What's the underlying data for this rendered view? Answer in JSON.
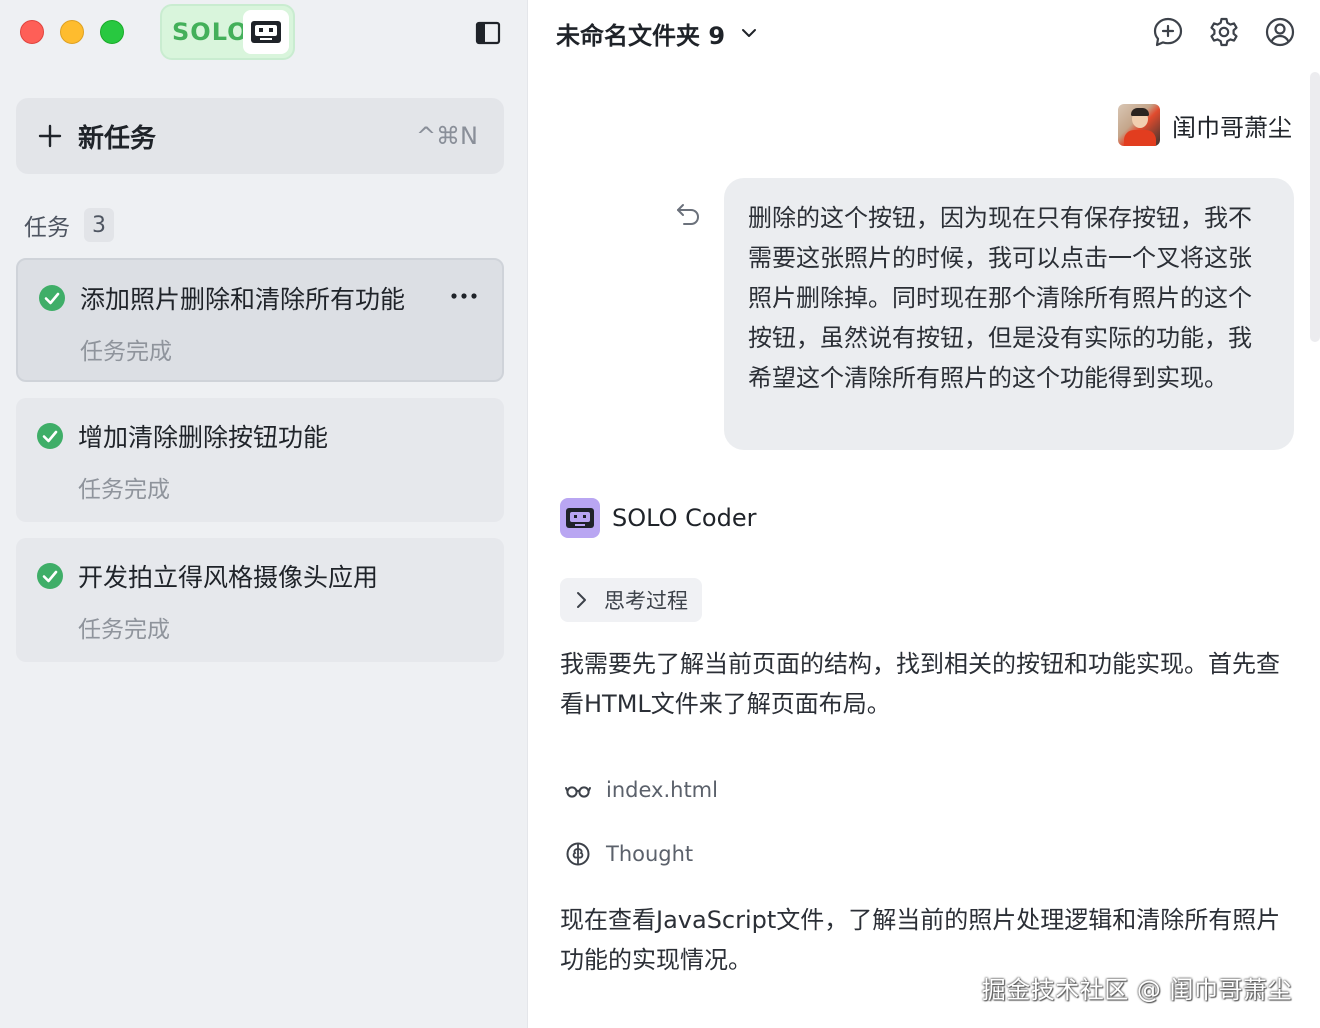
{
  "app": {
    "brand_label": "SOLO"
  },
  "sidebar": {
    "new_task": {
      "label": "新任务",
      "shortcut": "^⌘N"
    },
    "tasks_label": "任务",
    "tasks_count": "3",
    "tasks": [
      {
        "title": "添加照片删除和清除所有功能",
        "status": "任务完成",
        "active": true
      },
      {
        "title": "增加清除删除按钮功能",
        "status": "任务完成",
        "active": false
      },
      {
        "title": "开发拍立得风格摄像头应用",
        "status": "任务完成",
        "active": false
      }
    ]
  },
  "main": {
    "folder_title": "未命名文件夹 9",
    "user": {
      "name": "闺巾哥萧尘"
    },
    "user_message": "删除的这个按钮，因为现在只有保存按钮，我不需要这张照片的时候，我可以点击一个叉将这张照片删除掉。同时现在那个清除所有照片的这个按钮，虽然说有按钮，但是没有实际的功能，我希望这个清除所有照片的这个功能得到实现。",
    "agent": {
      "name": "SOLO Coder",
      "thinking_label": "思考过程",
      "message_1": "我需要先了解当前页面的结构，找到相关的按钮和功能实现。首先查看HTML文件来了解页面布局。",
      "tool_file": "index.html",
      "tool_thought": "Thought",
      "message_2": "现在查看JavaScript文件，了解当前的照片处理逻辑和清除所有照片功能的实现情况。"
    },
    "watermark": "掘金技术社区 @ 闺巾哥萧尘"
  },
  "colors": {
    "accent_green": "#43b05a",
    "check_green": "#3fae68",
    "coder_purple": "#b9a6f2"
  },
  "icons": [
    "panel-toggle-icon",
    "plus-icon",
    "check-circle-icon",
    "more-icon",
    "chevron-down-icon",
    "new-chat-icon",
    "gear-icon",
    "user-circle-icon",
    "undo-icon",
    "robot-icon",
    "chevron-right-icon",
    "glasses-icon",
    "brain-icon"
  ]
}
